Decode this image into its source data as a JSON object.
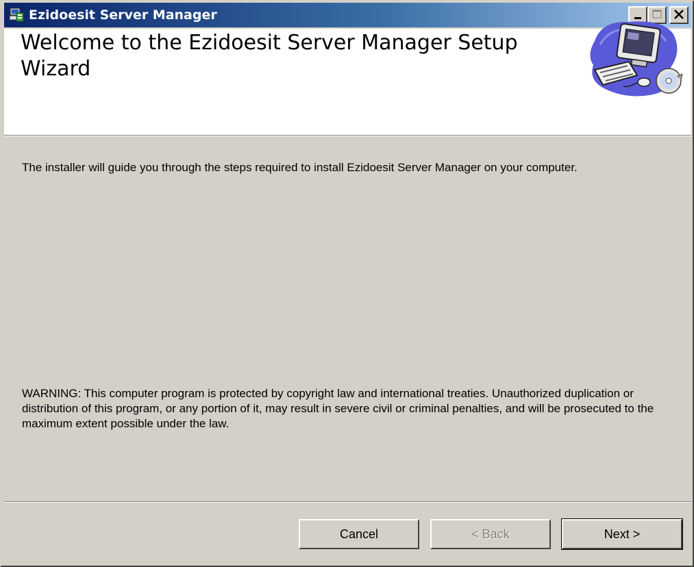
{
  "window": {
    "title": "Ezidoesit Server Manager",
    "icon": "installer-icon"
  },
  "banner": {
    "title": "Welcome to the Ezidoesit Server Manager Setup Wizard",
    "image": "computer-setup-icon"
  },
  "content": {
    "intro": "The installer will guide you through the steps required to install Ezidoesit Server Manager on your computer.",
    "warning": "WARNING: This computer program is protected by copyright law and international treaties. Unauthorized duplication or distribution of this program, or any portion of it, may result in severe civil or criminal penalties, and will be prosecuted to the maximum extent possible under the law."
  },
  "buttons": {
    "cancel": "Cancel",
    "back": "< Back",
    "next": "Next >"
  },
  "colors": {
    "titlebar_start": "#0a246a",
    "titlebar_end": "#a6caf0",
    "face": "#d4d0c8",
    "banner_bg": "#ffffff"
  }
}
